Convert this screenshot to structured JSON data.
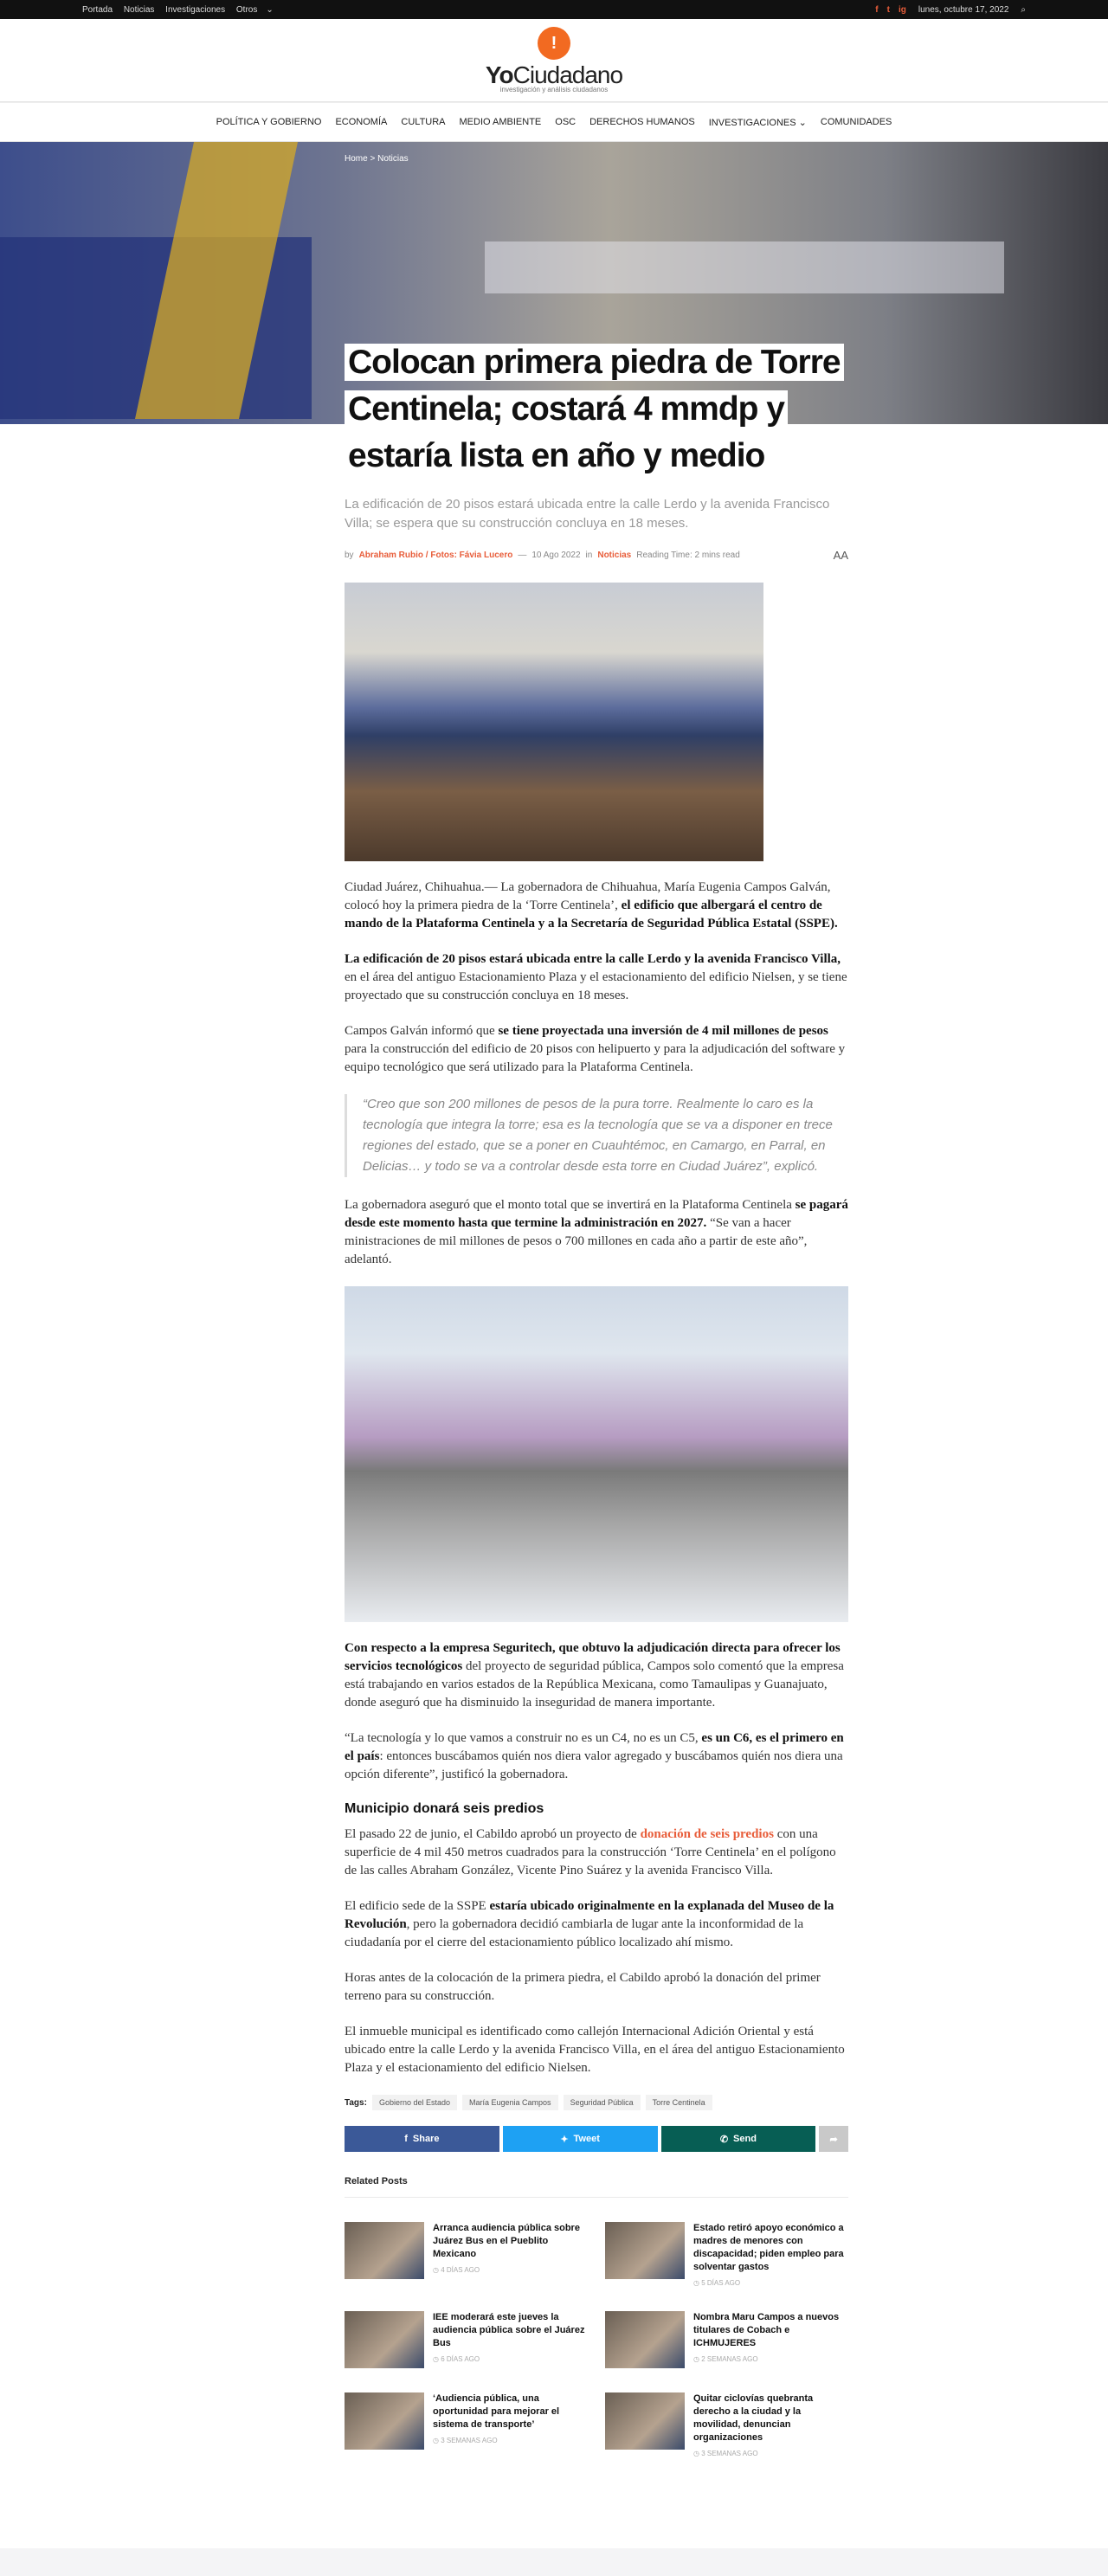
{
  "topbar": {
    "links": [
      "Portada",
      "Noticias",
      "Investigaciones",
      "Otros"
    ],
    "date": "lunes, octubre 17, 2022",
    "social": [
      "f",
      "t",
      "ig"
    ]
  },
  "logo": {
    "mark": "!",
    "text_bold": "Yo",
    "text": "Ciudadano",
    "tagline": "investigación y análisis ciudadanos"
  },
  "nav": [
    "POLÍTICA Y GOBIERNO",
    "ECONOMÍA",
    "CULTURA",
    "MEDIO AMBIENTE",
    "OSC",
    "DERECHOS HUMANOS",
    "INVESTIGACIONES",
    "COMUNIDADES"
  ],
  "breadcrumb": {
    "home": "Home",
    "sep": ">",
    "section": "Noticias"
  },
  "article": {
    "title": "Colocan primera piedra de Torre Centinela; costará 4 mmdp y estaría lista en año y medio",
    "subtitle": "La edificación de 20 pisos estará ubicada entre la calle Lerdo y la avenida Francisco Villa; se espera que su construcción concluya en 18 meses.",
    "by": "by",
    "author": "Abraham Rubio / Fotos: Fávia Lucero",
    "dash": "—",
    "date": "10 Ago 2022",
    "in": "in",
    "category": "Noticias",
    "reading": "Reading Time: 2 mins read",
    "font_size": "AA",
    "p1_a": "Ciudad Juárez, Chihuahua.— La gobernadora de Chihuahua, María Eugenia Campos Galván, colocó hoy la primera piedra de la ‘Torre Centinela’,",
    "p1_b": " el edificio que albergará el centro de mando de la Plataforma Centinela y a la Secretaría de Seguridad Pública Estatal (SSPE).",
    "p2_a": "La edificación de 20 pisos estará ubicada entre la calle Lerdo y la avenida Francisco Villa,",
    "p2_b": " en el área del antiguo Estacionamiento Plaza y el estacionamiento del edificio Nielsen, y se tiene proyectado que su construcción concluya en 18 meses.",
    "p3_a": "Campos Galván informó que ",
    "p3_b": "se tiene proyectada una inversión de 4 mil millones de pesos",
    "p3_c": " para la construcción del edificio de 20 pisos con helipuerto y para la adjudicación del software y equipo tecnológico que será utilizado para la Plataforma Centinela.",
    "quote": "“Creo que son 200 millones de pesos de la pura torre. Realmente lo caro es la tecnología que integra la torre; esa es la tecnología que se va a disponer en trece regiones del estado, que se a poner en Cuauhtémoc, en Camargo, en Parral, en Delicias… y todo se va a controlar desde esta torre en Ciudad Juárez”, explicó.",
    "p4_a": "La gobernadora aseguró que el monto total que se invertirá en la Plataforma Centinela ",
    "p4_b": "se pagará desde este momento hasta que termine la administración en 2027.",
    "p4_c": " “Se van a hacer ministraciones de mil millones de pesos o 700 millones en cada año a partir de este año”, adelantó.",
    "p5_a": "Con respecto a la empresa Seguritech, que obtuvo la adjudicación directa para ofrecer los servicios tecnológicos",
    "p5_b": " del proyecto de seguridad pública, Campos solo comentó que la empresa está trabajando en varios estados de la República Mexicana, como Tamaulipas y Guanajuato, donde aseguró que ha disminuido la inseguridad de manera importante.",
    "p6_a": "“La tecnología y lo que vamos a construir no es un C4, no es un C5, ",
    "p6_b": "es un C6, es el primero en el país",
    "p6_c": ": entonces buscábamos quién nos diera valor agregado y buscábamos quién nos diera una opción diferente”, justificó la gobernadora.",
    "h3": "Municipio donará seis predios",
    "p7_a": "El pasado 22 de junio, el Cabildo aprobó un proyecto de ",
    "p7_link": "donación de seis predios",
    "p7_c": " con una superficie de 4 mil 450 metros cuadrados para la construcción ‘Torre Centinela’ en el polígono de las calles Abraham González, Vicente Pino Suárez y la avenida Francisco Villa.",
    "p8_a": "El edificio sede de la SSPE ",
    "p8_b": "estaría ubicado originalmente en la explanada del Museo de la Revolución",
    "p8_c": ", pero la gobernadora decidió cambiarla de lugar ante la inconformidad de la ciudadanía por el cierre del estacionamiento público localizado ahí mismo.",
    "p9": "Horas antes de la colocación de la primera piedra, el Cabildo aprobó la donación del primer terreno para su construcción.",
    "p10": "El inmueble municipal es identificado como callejón Internacional Adición Oriental y está ubicado entre la calle Lerdo y la avenida Francisco Villa, en el área del antiguo Estacionamiento Plaza y el estacionamiento del edificio Nielsen."
  },
  "tags": {
    "label": "Tags:",
    "items": [
      "Gobierno del Estado",
      "María Eugenia Campos",
      "Seguridad Pública",
      "Torre Centinela"
    ]
  },
  "share": {
    "facebook": "Share",
    "twitter": "Tweet",
    "whatsapp": "Send"
  },
  "related": {
    "heading": "Related Posts",
    "items": [
      {
        "title": "Arranca audiencia pública sobre Juárez Bus en el Pueblito Mexicano",
        "date": "4 DÍAS AGO"
      },
      {
        "title": "Estado retiró apoyo económico a madres de menores con discapacidad; piden empleo para solventar gastos",
        "date": "5 DÍAS AGO"
      },
      {
        "title": "IEE moderará este jueves la audiencia pública sobre el Juárez Bus",
        "date": "6 DÍAS AGO"
      },
      {
        "title": "Nombra Maru Campos a nuevos titulares de Cobach e ICHMUJERES",
        "date": "2 SEMANAS AGO"
      },
      {
        "title": "‘Audiencia pública, una oportunidad para mejorar el sistema de transporte’",
        "date": "3 SEMANAS AGO"
      },
      {
        "title": "Quitar ciclovías quebranta derecho a la ciudad y la movilidad, denuncian organizaciones",
        "date": "3 SEMANAS AGO"
      }
    ]
  }
}
